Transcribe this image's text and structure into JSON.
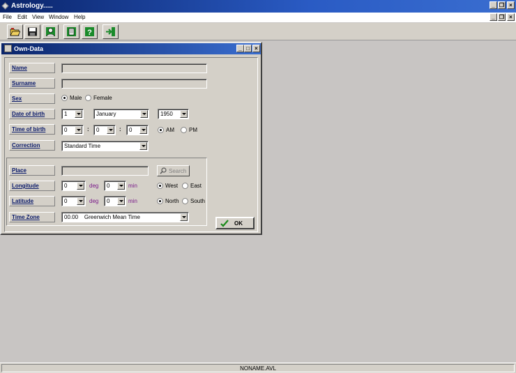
{
  "app": {
    "title": "Astrology....."
  },
  "menu": [
    "File",
    "Edit",
    "View",
    "Window",
    "Help"
  ],
  "toolbar": {
    "buttons": [
      "open-folder-icon",
      "save-disk-icon",
      "person-icon",
      "document-icon",
      "help-icon",
      "exit-icon"
    ]
  },
  "window": {
    "title": "Own-Data",
    "labels": {
      "name": "Name",
      "surname": "Surname",
      "sex": "Sex",
      "date_of_birth": "Date of birth",
      "time_of_birth": "Time of birth",
      "correction": "Correction",
      "place": "Place",
      "longitude": "Longitude",
      "latitude": "Latitude",
      "time_zone": "Time Zone"
    },
    "name_value": "",
    "surname_value": "",
    "sex": {
      "male": "Male",
      "female": "Female",
      "selected": "Male"
    },
    "date": {
      "day": "1",
      "month": "January",
      "year": "1950"
    },
    "time": {
      "hour": "0",
      "minute": "0",
      "second": "0",
      "separator": ":",
      "am": "AM",
      "pm": "PM",
      "selected": "AM"
    },
    "correction_value": "Standard Time",
    "place_value": "",
    "search_label": "Search",
    "longitude": {
      "deg": "0",
      "min": "0",
      "deg_unit": "deg",
      "min_unit": "min",
      "west": "West",
      "east": "East",
      "selected": "West"
    },
    "latitude": {
      "deg": "0",
      "min": "0",
      "deg_unit": "deg",
      "min_unit": "min",
      "north": "North",
      "south": "South",
      "selected": "North"
    },
    "time_zone_value": "00.00    Greenwich Mean Time",
    "ok_label": "OK"
  },
  "status": {
    "filename": "NONAME.AVL"
  },
  "colors": {
    "title_bar": "#0a246a",
    "label_text": "#0a1a6a",
    "unit_text": "#7a1a8a",
    "ok_check": "#1a8a1a"
  }
}
